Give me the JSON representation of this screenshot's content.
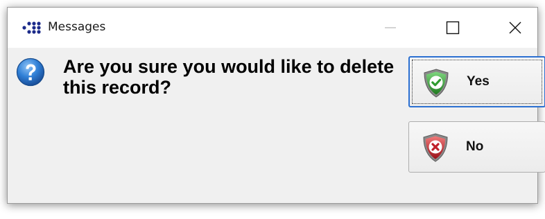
{
  "window": {
    "title": "Messages",
    "controls": {
      "minimize": "minimize-icon",
      "maximize": "maximize-icon",
      "close": "close-icon"
    }
  },
  "dialog": {
    "icon": "question-icon",
    "message": "Are you sure you would like to delete this record?",
    "buttons": {
      "yes_label": "Yes",
      "yes_icon": "shield-check-icon",
      "no_label": "No",
      "no_icon": "shield-x-icon"
    }
  },
  "colors": {
    "accent_focus": "#2a6fd1",
    "yes_shield": "#2e9b2e",
    "no_shield": "#c0202a",
    "question_icon": "#2f7fd6"
  }
}
